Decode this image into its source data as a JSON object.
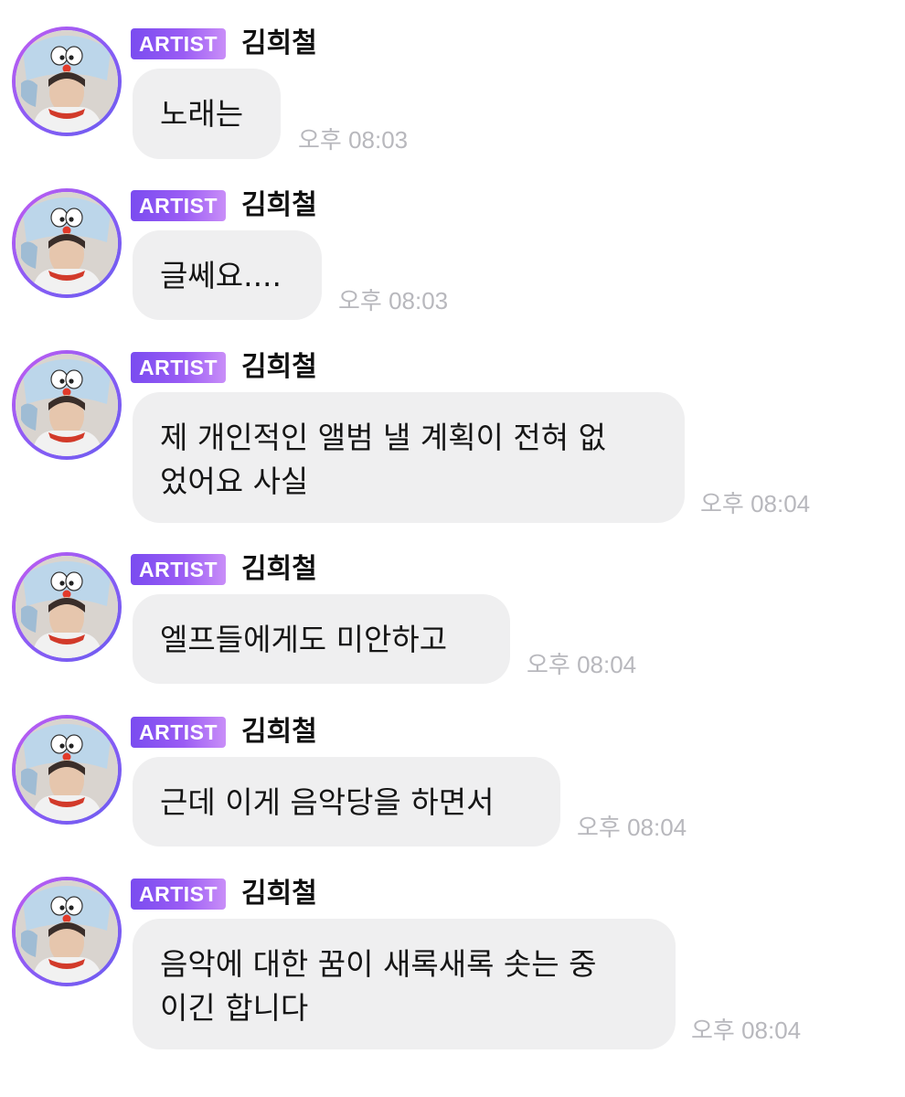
{
  "messages": [
    {
      "badge": "ARTIST",
      "sender": "김희철",
      "text": "노래는",
      "time": "오후 08:03"
    },
    {
      "badge": "ARTIST",
      "sender": "김희철",
      "text": "글쎄요....",
      "time": "오후 08:03"
    },
    {
      "badge": "ARTIST",
      "sender": "김희철",
      "line1": "제 개인적인 앨범 낼 계획이 전혀 없",
      "line2": "었어요 사실",
      "time": "오후 08:04"
    },
    {
      "badge": "ARTIST",
      "sender": "김희철",
      "text": "엘프들에게도 미안하고",
      "time": "오후 08:04"
    },
    {
      "badge": "ARTIST",
      "sender": "김희철",
      "text": "근데 이게 음악당을 하면서",
      "time": "오후 08:04"
    },
    {
      "badge": "ARTIST",
      "sender": "김희철",
      "line1": "음악에 대한 꿈이 새록새록 솟는 중",
      "line2": "이긴 합니다",
      "time": "오후 08:04"
    }
  ],
  "colors": {
    "badge_gradient_start": "#7a4cf0",
    "badge_gradient_end": "#c98ef8",
    "bubble_background": "#efeff0",
    "timestamp": "#b8b8bd",
    "avatar_ring": "#9a5cf4"
  },
  "icons": {
    "avatar": "avatar-icon"
  }
}
